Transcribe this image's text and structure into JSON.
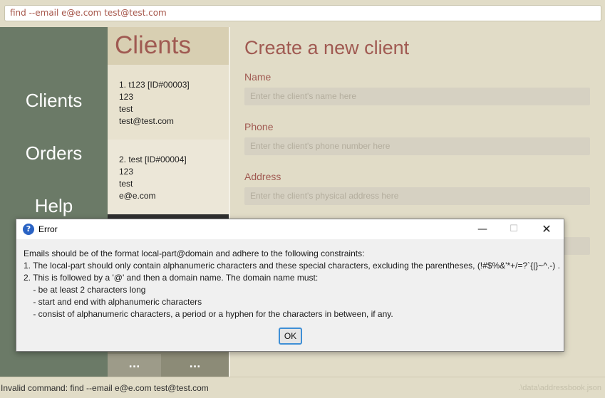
{
  "command_box": {
    "value": "find --email e@e.com test@test.com"
  },
  "nav": {
    "items": [
      {
        "label": "Clients"
      },
      {
        "label": "Orders"
      },
      {
        "label": "Help"
      }
    ]
  },
  "client_list": {
    "title": "Clients",
    "cards": [
      {
        "header": "1.   t123 [ID#00003]",
        "phone": "123",
        "address": "test",
        "email": "test@test.com"
      },
      {
        "header": "2.   test [ID#00004]",
        "phone": "123",
        "address": "test",
        "email": "e@e.com"
      }
    ],
    "more_left": "...",
    "more_right": "..."
  },
  "form": {
    "title": "Create a new client",
    "fields": [
      {
        "label": "Name",
        "placeholder": "Enter the client's name here"
      },
      {
        "label": "Phone",
        "placeholder": "Enter the client's phone number here"
      },
      {
        "label": "Address",
        "placeholder": "Enter the client's physical address here"
      }
    ]
  },
  "status_bar": {
    "message": "Invalid command: find --email e@e.com test@test.com",
    "path": ".\\data\\addressbook.json"
  },
  "dialog": {
    "title": "Error",
    "icon": "question-icon",
    "lines": [
      "Emails should be of the format local-part@domain and adhere to the following constraints:",
      "1. The local-part should only contain alphanumeric characters and these special characters, excluding the parentheses, (!#$%&'*+/=?`{|}~^.-) .",
      "2. This is followed by a '@' and then a domain name. The domain name must:",
      "    - be at least 2 characters long",
      "    - start and end with alphanumeric characters",
      "    - consist of alphanumeric characters, a period or a hyphen for the characters in between, if any."
    ],
    "ok_label": "OK",
    "minimize_glyph": "—",
    "maximize_glyph": "☐",
    "close_glyph": "✕"
  }
}
